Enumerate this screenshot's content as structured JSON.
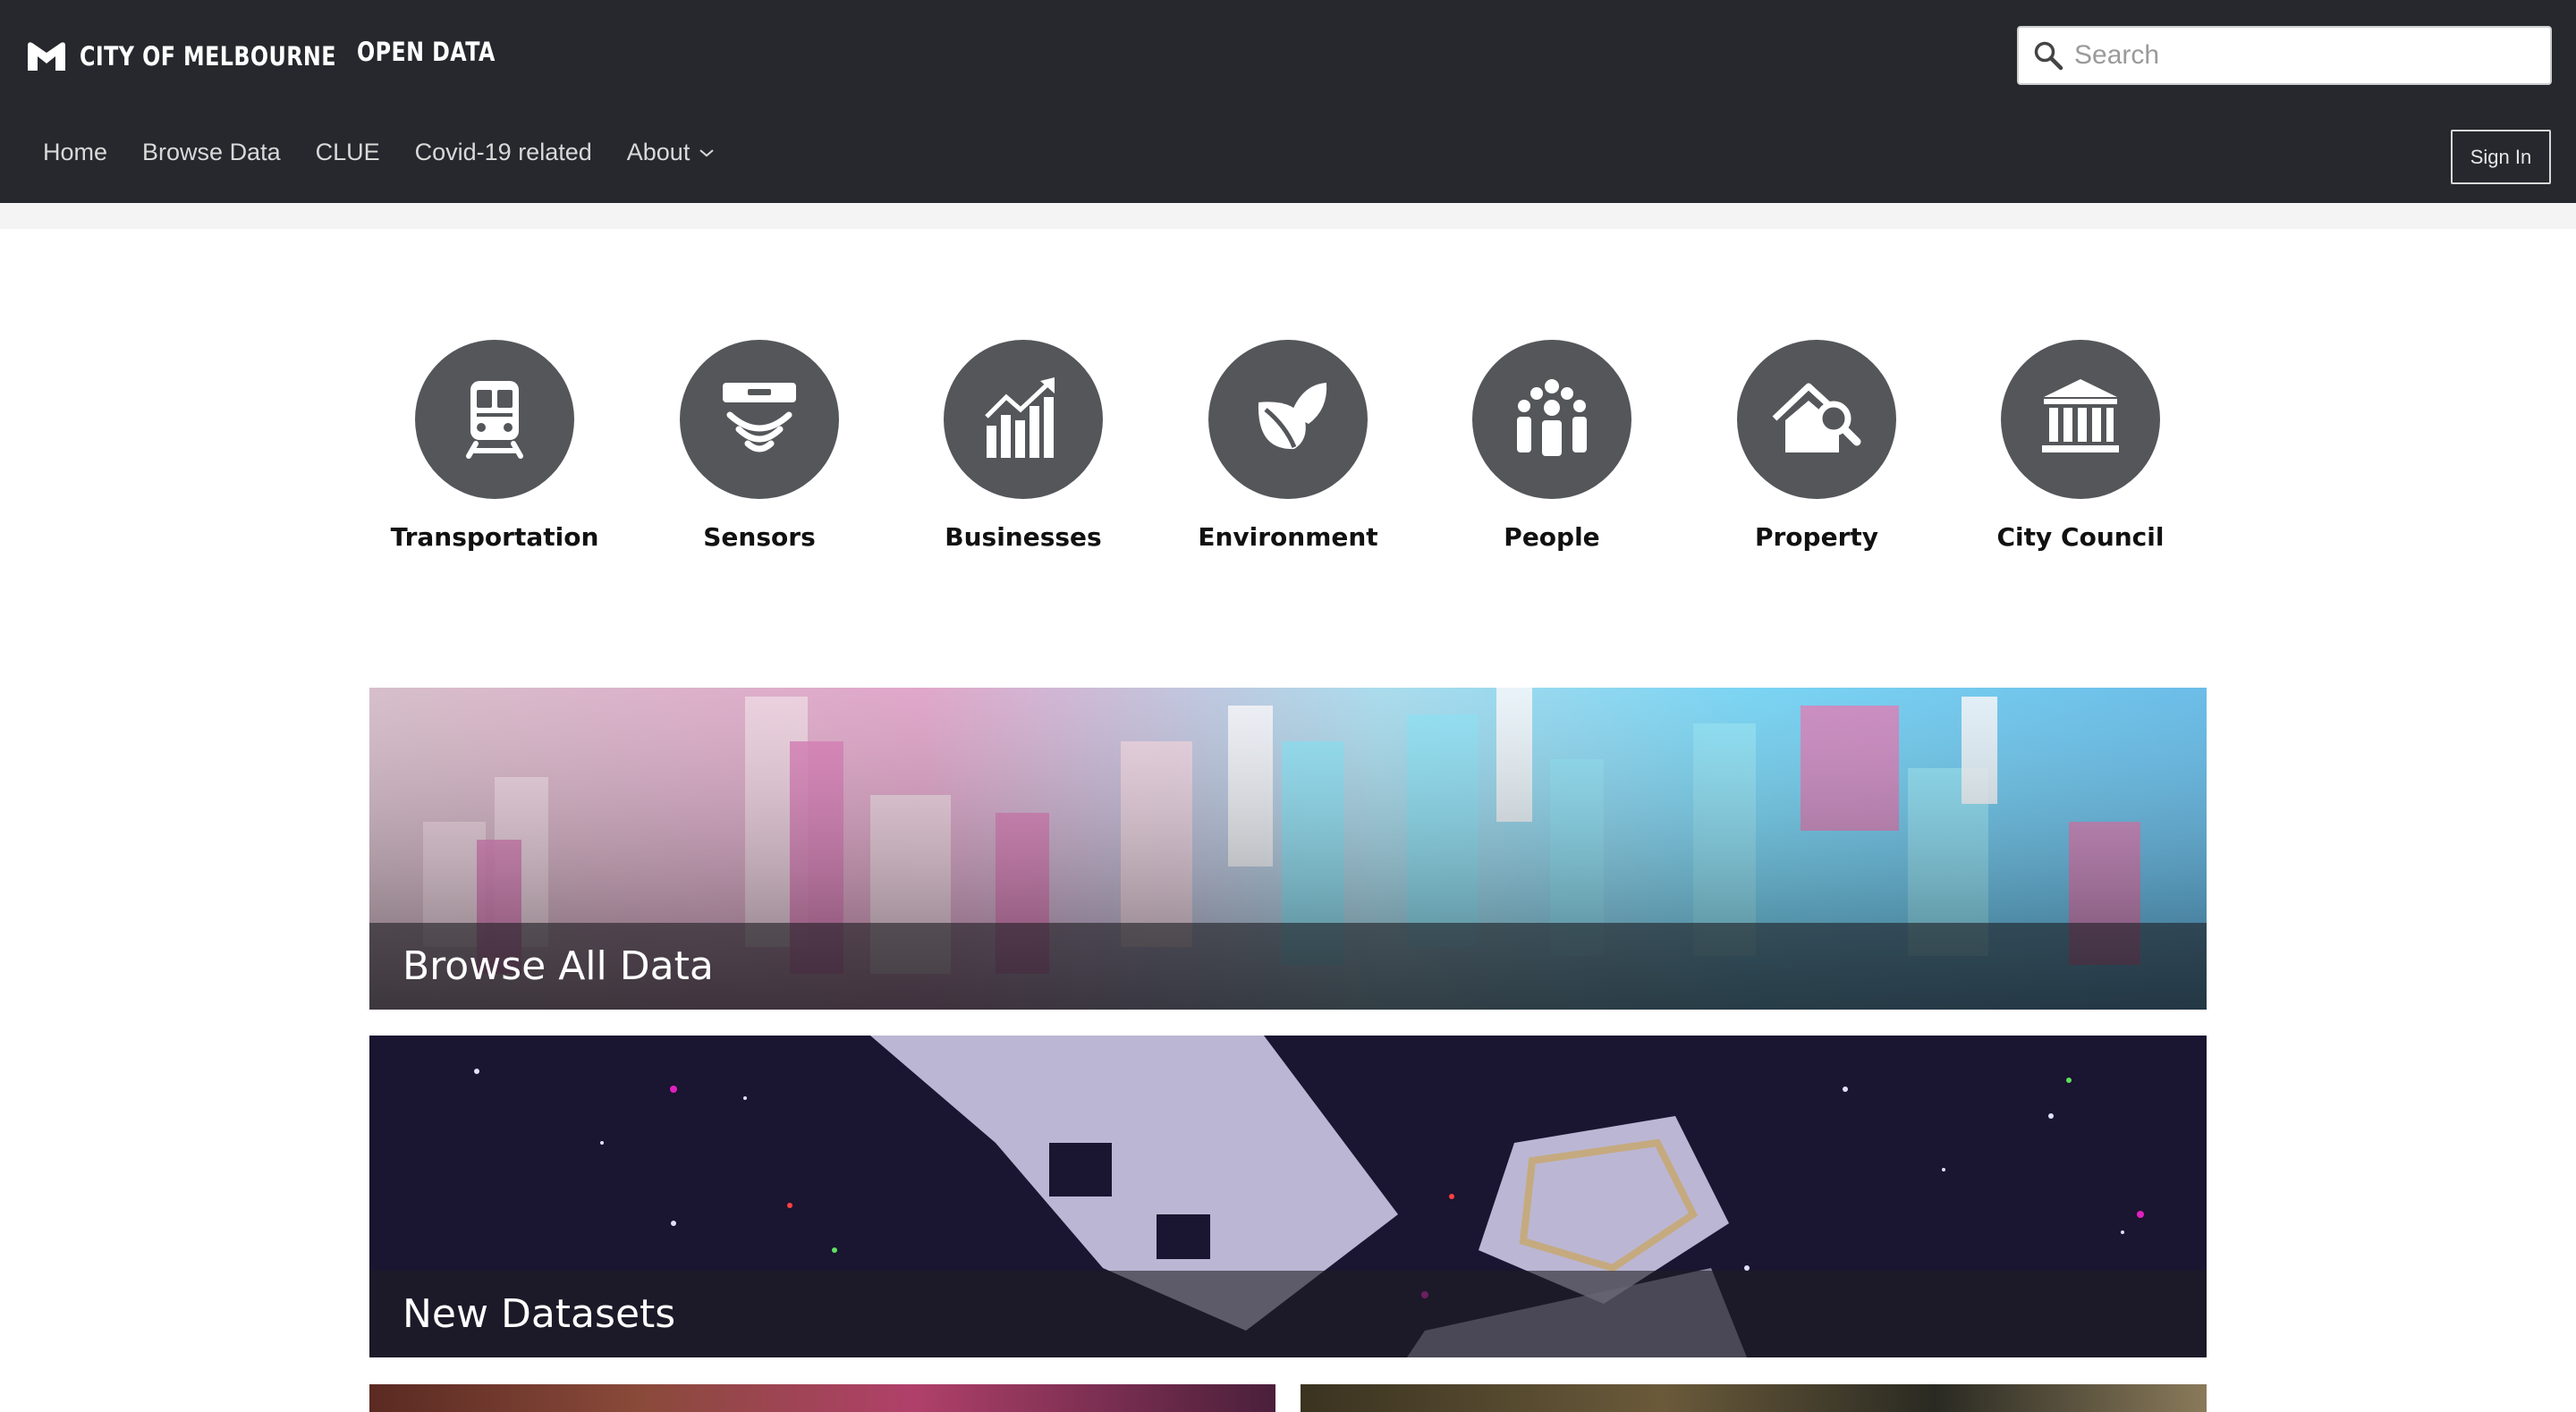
{
  "header": {
    "brand_name": "CITY OF MELBOURNE",
    "brand_sub": "OPEN DATA",
    "search": {
      "placeholder": "Search",
      "value": ""
    },
    "nav": [
      {
        "label": "Home"
      },
      {
        "label": "Browse Data"
      },
      {
        "label": "CLUE"
      },
      {
        "label": "Covid-19 related"
      },
      {
        "label": "About",
        "has_dropdown": true
      }
    ],
    "sign_in_label": "Sign In",
    "colors": {
      "bar": "#26282d",
      "nav_text": "#d9d9d9"
    }
  },
  "categories": [
    {
      "label": "Transportation",
      "icon": "train-icon"
    },
    {
      "label": "Sensors",
      "icon": "sensor-icon"
    },
    {
      "label": "Businesses",
      "icon": "bar-chart-growth-icon"
    },
    {
      "label": "Environment",
      "icon": "leaf-icon"
    },
    {
      "label": "People",
      "icon": "people-icon"
    },
    {
      "label": "Property",
      "icon": "house-search-icon"
    },
    {
      "label": "City Council",
      "icon": "government-building-icon"
    }
  ],
  "category_circle_color": "#54565a",
  "banners": [
    {
      "caption": "Browse All Data",
      "image": "city-model-aerial"
    },
    {
      "caption": "New Datasets",
      "image": "point-cloud-visualisation"
    }
  ]
}
